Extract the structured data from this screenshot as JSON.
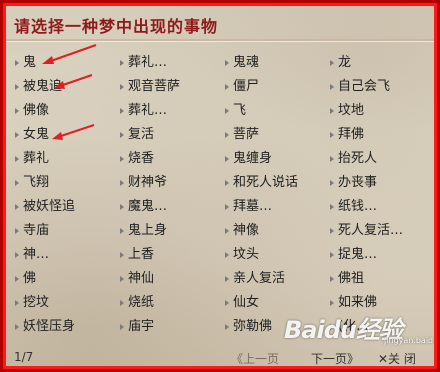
{
  "title": "请选择一种梦中出现的事物",
  "rows": [
    [
      "鬼",
      "葬礼…",
      "鬼魂",
      "龙"
    ],
    [
      "被鬼追",
      "观音菩萨",
      "僵尸",
      "自己会飞"
    ],
    [
      "佛像",
      "葬礼…",
      "飞",
      "坟地"
    ],
    [
      "女鬼",
      "复活",
      "菩萨",
      "拜佛"
    ],
    [
      "葬礼",
      "烧香",
      "鬼缠身",
      "抬死人"
    ],
    [
      "飞翔",
      "财神爷",
      "和死人说话",
      "办丧事"
    ],
    [
      "被妖怪追",
      "魔鬼…",
      "拜墓…",
      "纸钱…"
    ],
    [
      "寺庙",
      "鬼上身",
      "神像",
      "死人复活…"
    ],
    [
      "神…",
      "上香",
      "坟头",
      "捉鬼…"
    ],
    [
      "佛",
      "神仙",
      "亲人复活",
      "佛祖"
    ],
    [
      "挖坟",
      "烧纸",
      "仙女",
      "如来佛"
    ],
    [
      "妖怪压身",
      "庙宇",
      "弥勒佛",
      "(化…"
    ]
  ],
  "footer": {
    "page_info": "1/7",
    "prev": "《上一页",
    "next": "下一页》",
    "close": "✕关 闭"
  },
  "watermark": {
    "text": "Baidu经验",
    "sub": "jingyan.baidu.com"
  },
  "colors": {
    "title": "#8e1b1b",
    "arrow": "#e02020",
    "border": "#ff1a1a"
  }
}
